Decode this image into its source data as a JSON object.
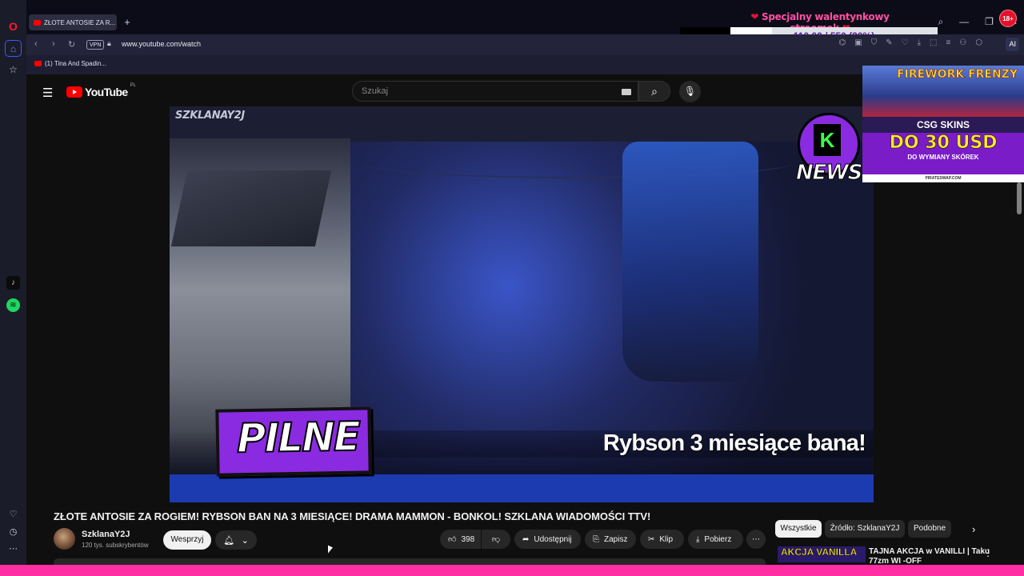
{
  "browser": {
    "tab_title": "ZŁOTE ANTOSIE ZA R...",
    "url": "www.youtube.com/watch",
    "vpn_label": "VPN",
    "ai_label": "AI",
    "bookmark": "(1) Tina And Spadin...",
    "age_badge": "18+"
  },
  "overlay": {
    "goal_title": "Specjalny walentynkowy streemek",
    "goal_progress": "110.00 / 550 (20%)",
    "goal_fraction": 0.2
  },
  "youtube": {
    "logo": "YouTube",
    "region": "PL",
    "search_placeholder": "Szukaj",
    "video": {
      "watermark": "SZKLANAY2J",
      "news_label": "NEWS",
      "pilne": "PILNE",
      "ticker": "Rybson 3 miesiące bana!"
    },
    "title": "ZŁOTE ANTOSIE ZA ROGIEM! RYBSON BAN NA 3 MIESIĄCE! DRAMA MAMMON - BONKOL! SZKLANA WIADOMOŚCI TTV!",
    "channel": {
      "name": "SzklanaY2J",
      "subs": "120 tys. subskrybentów",
      "support": "Wesprzyj"
    },
    "actions": {
      "likes": "398",
      "share": "Udostępnij",
      "save": "Zapisz",
      "clip": "Klip",
      "download": "Pobierz"
    },
    "chips": [
      "Wszystkie",
      "Źródło: SzklanaY2J",
      "Podobne"
    ],
    "recommendation": {
      "thumb_text": "AKCJA VANILLA",
      "title": "TAJNA AKCJA w VANILLI | Taku 77zm WI -OFF"
    }
  },
  "ad": {
    "headline": "FIREWORK FRENZY",
    "brand": "CSG SKINS",
    "offer": "DO 30 USD",
    "offer_sub": "DO WYMIANY SKÓREK",
    "source": "PIRATESWAP.COM"
  },
  "colors": {
    "accent_pink": "#ff2ea2",
    "youtube_red": "#ff0000",
    "purple": "#8a2be2"
  }
}
